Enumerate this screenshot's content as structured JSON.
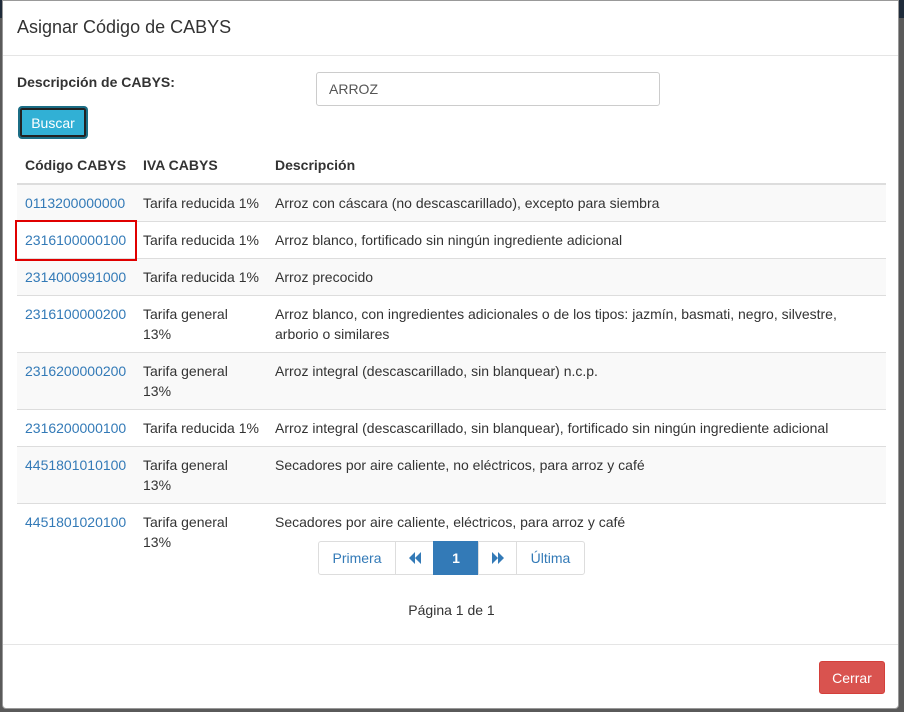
{
  "modal": {
    "title": "Asignar Código de CABYS"
  },
  "search": {
    "label": "Descripción de CABYS:",
    "value": "ARROZ",
    "button_label": "Buscar"
  },
  "table": {
    "headers": [
      "Código CABYS",
      "IVA CABYS",
      "Descripción"
    ],
    "rows": [
      {
        "code": "0113200000000",
        "iva": "Tarifa reducida 1%",
        "description": "Arroz con cáscara (no descascarillado), excepto para siembra"
      },
      {
        "code": "2316100000100",
        "iva": "Tarifa reducida 1%",
        "description": "Arroz blanco, fortificado sin ningún ingrediente adicional"
      },
      {
        "code": "2314000991000",
        "iva": "Tarifa reducida 1%",
        "description": "Arroz precocido"
      },
      {
        "code": "2316100000200",
        "iva": "Tarifa general 13%",
        "description": "Arroz blanco, con ingredientes adicionales o de los tipos: jazmín, basmati, negro, silvestre, arborio o similares"
      },
      {
        "code": "2316200000200",
        "iva": "Tarifa general 13%",
        "description": "Arroz integral (descascarillado, sin blanquear) n.c.p."
      },
      {
        "code": "2316200000100",
        "iva": "Tarifa reducida 1%",
        "description": "Arroz integral (descascarillado, sin blanquear), fortificado sin ningún ingrediente adicional"
      },
      {
        "code": "4451801010100",
        "iva": "Tarifa general 13%",
        "description": "Secadores por aire caliente, no eléctricos, para arroz y café"
      },
      {
        "code": "4451801020100",
        "iva": "Tarifa general 13%",
        "description": "Secadores por aire caliente, eléctricos, para arroz y café"
      }
    ]
  },
  "pagination": {
    "first_label": "Primera",
    "prev_icon": "double-chevron-left-icon",
    "current_page": "1",
    "next_icon": "double-chevron-right-icon",
    "last_label": "Última",
    "info": "Página 1 de 1"
  },
  "footer": {
    "close_label": "Cerrar"
  },
  "colors": {
    "link": "#337ab7",
    "search_button": "#31b0d5",
    "close_button": "#d9534f",
    "highlight": "#e00000"
  }
}
